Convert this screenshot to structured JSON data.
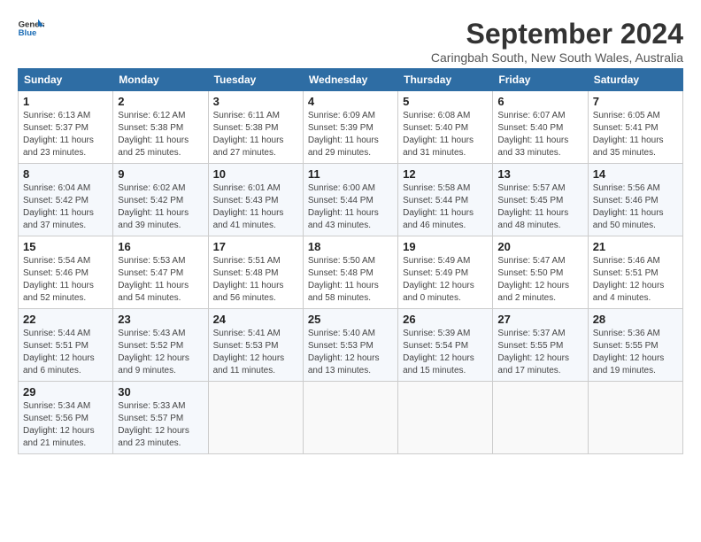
{
  "logo": {
    "line1": "General",
    "line2": "Blue"
  },
  "title": "September 2024",
  "subtitle": "Caringbah South, New South Wales, Australia",
  "days_header": [
    "Sunday",
    "Monday",
    "Tuesday",
    "Wednesday",
    "Thursday",
    "Friday",
    "Saturday"
  ],
  "weeks": [
    [
      {
        "day": "1",
        "sunrise": "6:13 AM",
        "sunset": "5:37 PM",
        "daylight": "11 hours and 23 minutes."
      },
      {
        "day": "2",
        "sunrise": "6:12 AM",
        "sunset": "5:38 PM",
        "daylight": "11 hours and 25 minutes."
      },
      {
        "day": "3",
        "sunrise": "6:11 AM",
        "sunset": "5:38 PM",
        "daylight": "11 hours and 27 minutes."
      },
      {
        "day": "4",
        "sunrise": "6:09 AM",
        "sunset": "5:39 PM",
        "daylight": "11 hours and 29 minutes."
      },
      {
        "day": "5",
        "sunrise": "6:08 AM",
        "sunset": "5:40 PM",
        "daylight": "11 hours and 31 minutes."
      },
      {
        "day": "6",
        "sunrise": "6:07 AM",
        "sunset": "5:40 PM",
        "daylight": "11 hours and 33 minutes."
      },
      {
        "day": "7",
        "sunrise": "6:05 AM",
        "sunset": "5:41 PM",
        "daylight": "11 hours and 35 minutes."
      }
    ],
    [
      {
        "day": "8",
        "sunrise": "6:04 AM",
        "sunset": "5:42 PM",
        "daylight": "11 hours and 37 minutes."
      },
      {
        "day": "9",
        "sunrise": "6:02 AM",
        "sunset": "5:42 PM",
        "daylight": "11 hours and 39 minutes."
      },
      {
        "day": "10",
        "sunrise": "6:01 AM",
        "sunset": "5:43 PM",
        "daylight": "11 hours and 41 minutes."
      },
      {
        "day": "11",
        "sunrise": "6:00 AM",
        "sunset": "5:44 PM",
        "daylight": "11 hours and 43 minutes."
      },
      {
        "day": "12",
        "sunrise": "5:58 AM",
        "sunset": "5:44 PM",
        "daylight": "11 hours and 46 minutes."
      },
      {
        "day": "13",
        "sunrise": "5:57 AM",
        "sunset": "5:45 PM",
        "daylight": "11 hours and 48 minutes."
      },
      {
        "day": "14",
        "sunrise": "5:56 AM",
        "sunset": "5:46 PM",
        "daylight": "11 hours and 50 minutes."
      }
    ],
    [
      {
        "day": "15",
        "sunrise": "5:54 AM",
        "sunset": "5:46 PM",
        "daylight": "11 hours and 52 minutes."
      },
      {
        "day": "16",
        "sunrise": "5:53 AM",
        "sunset": "5:47 PM",
        "daylight": "11 hours and 54 minutes."
      },
      {
        "day": "17",
        "sunrise": "5:51 AM",
        "sunset": "5:48 PM",
        "daylight": "11 hours and 56 minutes."
      },
      {
        "day": "18",
        "sunrise": "5:50 AM",
        "sunset": "5:48 PM",
        "daylight": "11 hours and 58 minutes."
      },
      {
        "day": "19",
        "sunrise": "5:49 AM",
        "sunset": "5:49 PM",
        "daylight": "12 hours and 0 minutes."
      },
      {
        "day": "20",
        "sunrise": "5:47 AM",
        "sunset": "5:50 PM",
        "daylight": "12 hours and 2 minutes."
      },
      {
        "day": "21",
        "sunrise": "5:46 AM",
        "sunset": "5:51 PM",
        "daylight": "12 hours and 4 minutes."
      }
    ],
    [
      {
        "day": "22",
        "sunrise": "5:44 AM",
        "sunset": "5:51 PM",
        "daylight": "12 hours and 6 minutes."
      },
      {
        "day": "23",
        "sunrise": "5:43 AM",
        "sunset": "5:52 PM",
        "daylight": "12 hours and 9 minutes."
      },
      {
        "day": "24",
        "sunrise": "5:41 AM",
        "sunset": "5:53 PM",
        "daylight": "12 hours and 11 minutes."
      },
      {
        "day": "25",
        "sunrise": "5:40 AM",
        "sunset": "5:53 PM",
        "daylight": "12 hours and 13 minutes."
      },
      {
        "day": "26",
        "sunrise": "5:39 AM",
        "sunset": "5:54 PM",
        "daylight": "12 hours and 15 minutes."
      },
      {
        "day": "27",
        "sunrise": "5:37 AM",
        "sunset": "5:55 PM",
        "daylight": "12 hours and 17 minutes."
      },
      {
        "day": "28",
        "sunrise": "5:36 AM",
        "sunset": "5:55 PM",
        "daylight": "12 hours and 19 minutes."
      }
    ],
    [
      {
        "day": "29",
        "sunrise": "5:34 AM",
        "sunset": "5:56 PM",
        "daylight": "12 hours and 21 minutes."
      },
      {
        "day": "30",
        "sunrise": "5:33 AM",
        "sunset": "5:57 PM",
        "daylight": "12 hours and 23 minutes."
      },
      null,
      null,
      null,
      null,
      null
    ]
  ]
}
